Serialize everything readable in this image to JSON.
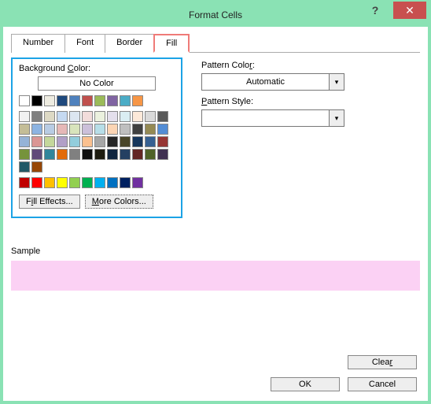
{
  "title": "Format Cells",
  "tabs": [
    "Number",
    "Font",
    "Border",
    "Fill"
  ],
  "activeTab": 3,
  "bg": {
    "label": "Background Color:",
    "noColor": "No Color",
    "fillEffects": "Fill Effects...",
    "moreColors": "More Colors..."
  },
  "pattern": {
    "colorLabel": "Pattern Color:",
    "colorValue": "Automatic",
    "styleLabel": "Pattern Style:",
    "styleValue": ""
  },
  "sample": {
    "label": "Sample",
    "color": "#fbd1f4"
  },
  "buttons": {
    "clear": "Clear",
    "ok": "OK",
    "cancel": "Cancel"
  },
  "colors": {
    "row1": [
      "#ffffff",
      "#000000",
      "#eeece1",
      "#1f497d",
      "#4f81bd",
      "#c0504d",
      "#9bbb59",
      "#8064a2",
      "#4bacc6",
      "#f79646"
    ],
    "theme": [
      [
        "#f2f2f2",
        "#7f7f7f",
        "#ddd9c4",
        "#c5d9f1",
        "#dce6f1",
        "#f2dcdb",
        "#ebf1de",
        "#e4dfec",
        "#daeef3",
        "#fde9d9"
      ],
      [
        "#d9d9d9",
        "#595959",
        "#c4bd97",
        "#8db4e2",
        "#b8cce4",
        "#e6b8b7",
        "#d8e4bc",
        "#ccc0da",
        "#b7dee8",
        "#fcd5b4"
      ],
      [
        "#bfbfbf",
        "#404040",
        "#948a54",
        "#538dd5",
        "#95b3d7",
        "#da9694",
        "#c4d79b",
        "#b1a0c7",
        "#92cddc",
        "#fac08f"
      ],
      [
        "#a6a6a6",
        "#262626",
        "#494529",
        "#16365c",
        "#366092",
        "#963634",
        "#76933c",
        "#60497a",
        "#31869b",
        "#e26b0a"
      ],
      [
        "#808080",
        "#0d0d0d",
        "#1d1b10",
        "#0f243e",
        "#244062",
        "#632523",
        "#4f6228",
        "#403151",
        "#215967",
        "#974706"
      ]
    ],
    "standard": [
      "#c00000",
      "#ff0000",
      "#ffc000",
      "#ffff00",
      "#92d050",
      "#00b050",
      "#00b0f0",
      "#0070c0",
      "#002060",
      "#7030a0"
    ]
  }
}
